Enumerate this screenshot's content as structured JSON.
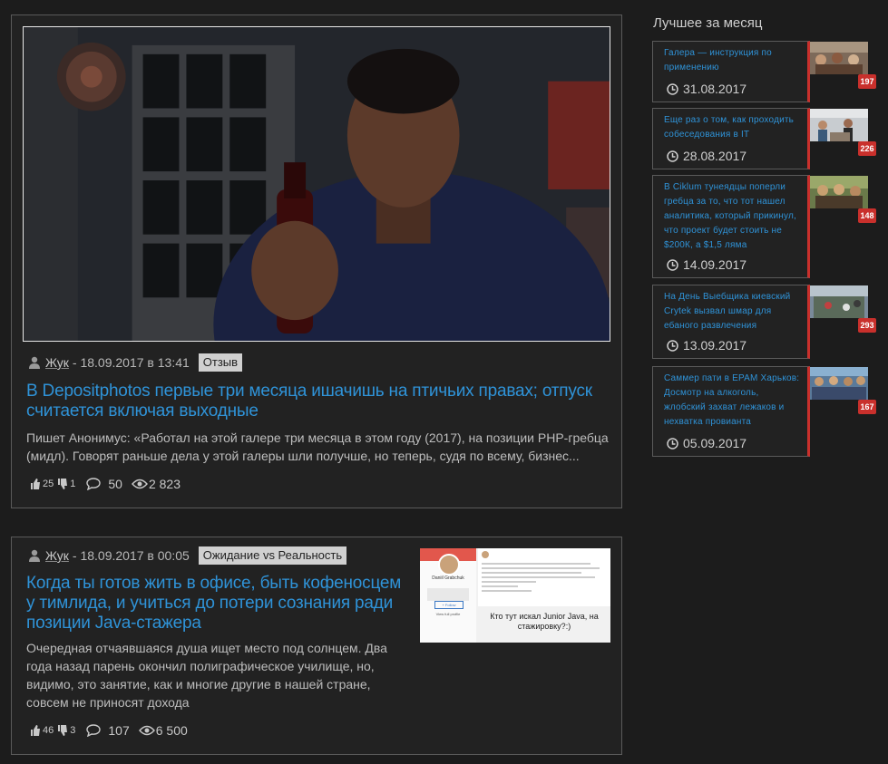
{
  "posts": [
    {
      "author": "Жук",
      "date": "- 18.09.2017 в 13:41",
      "tag": "Отзыв",
      "title": "В Depositphotos первые три месяца ишачишь на птичьих правах; отпуск считается включая выходные",
      "excerpt": "Пишет Анонимус: «Работал на этой галере три месяца в этом году (2017), на позиции PHP-гребца (мидл). Говорят раньше дела у этой галеры шли получше, но теперь, судя по всему, бизнес...",
      "likes": "25",
      "dislikes": "1",
      "comments": "50",
      "views": "2 823"
    },
    {
      "author": "Жук",
      "date": "- 18.09.2017 в 00:05",
      "tag": "Ожидание vs Реальность",
      "title": "Когда ты готов жить в офисе, быть кофеносцем у тимлида, и учиться до потери сознания ради позиции Java-стажера",
      "excerpt": "Очередная отчаявшаяся душа ищет место под солнцем. Два года назад парень окончил полиграфическое училище, но, видимо, это занятие, как и многие другие в нашей стране, совсем не приносят дохода",
      "likes": "46",
      "dislikes": "3",
      "comments": "107",
      "views": "6 500",
      "preview": {
        "name": "Daniil Grabchuk",
        "view_profile": "View full profile",
        "follow": "+ Follow",
        "caption": "Кто тут искал Junior Java, на стажировку?:)"
      }
    }
  ],
  "sidebar": {
    "title": "Лучшее за месяц",
    "items": [
      {
        "title": "Галера — инструкция по применению",
        "date": "31.08.2017",
        "count": "197"
      },
      {
        "title": "Еще раз о том, как проходить собеседования в IT",
        "date": "28.08.2017",
        "count": "226"
      },
      {
        "title": "В Ciklum тунеядцы поперли гребца за то, что тот нашел аналитика, который прикинул, что проект будет стоить не $200К, а $1,5 ляма",
        "date": "14.09.2017",
        "count": "148"
      },
      {
        "title": "На День Выебщика киевский Crytek вызвал шмар для ебаного развлечения",
        "date": "13.09.2017",
        "count": "293"
      },
      {
        "title": "Саммер пати в EPAM Харьков: Досмотр на алкоголь, жлобский захват лежаков и нехватка провианта",
        "date": "05.09.2017",
        "count": "167"
      }
    ]
  },
  "colors": {
    "link": "#2f93d8",
    "accent": "#c9302c",
    "background": "#1c1c1c",
    "card": "#222222"
  }
}
